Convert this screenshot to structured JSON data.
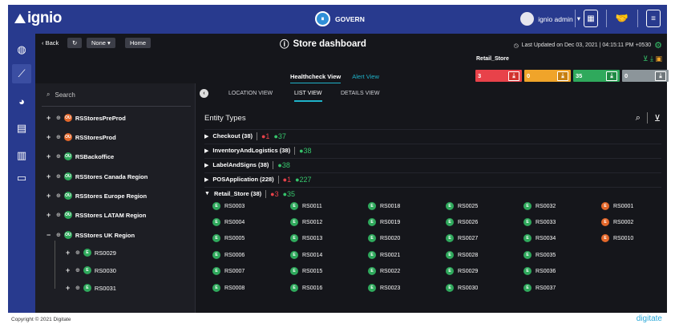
{
  "topbar": {
    "logo": "ignio",
    "govern_label": "GOVERN",
    "user_label": "ignio admin",
    "icon_names": [
      "calendar-icon",
      "handshake-icon",
      "document-icon"
    ]
  },
  "rail": {
    "items": [
      "globe-icon",
      "chart-icon",
      "pie-icon",
      "tree-icon",
      "report-icon",
      "monitor-icon"
    ]
  },
  "subheader": {
    "back_label": "Back",
    "refresh_icon": "refresh-icon",
    "none_label": "None",
    "home_label": "Home",
    "title": "Store dashboard",
    "last_updated": "Last Updated on Dec 03, 2021 | 04:15:11 PM +0530",
    "retail_label": "Retail_Store",
    "view_tabs": [
      "Healthcheck View",
      "Alert View"
    ],
    "tiles": [
      {
        "value": "3",
        "color": "#e8424a"
      },
      {
        "value": "0",
        "color": "#f0a42a"
      },
      {
        "value": "35",
        "color": "#2fa95c"
      },
      {
        "value": "0",
        "color": "#8c959a"
      }
    ]
  },
  "tree": {
    "search_placeholder": "Search",
    "items": [
      {
        "label": "RSStoresPreProd",
        "badge": "OU"
      },
      {
        "label": "RSStoresProd",
        "badge": "OU"
      },
      {
        "label": "RSBackoffice",
        "badge": "OU"
      },
      {
        "label": "RSStores Canada Region",
        "badge": "OU"
      },
      {
        "label": "RSStores Europe Region",
        "badge": "OU"
      },
      {
        "label": "RSStores LATAM Region",
        "badge": "OU"
      },
      {
        "label": "RSStores UK Region",
        "badge": "OU"
      }
    ],
    "children": [
      {
        "label": "RS0029",
        "badge": "E"
      },
      {
        "label": "RS0030",
        "badge": "E"
      },
      {
        "label": "RS0031",
        "badge": "E"
      }
    ]
  },
  "content": {
    "tabs": [
      "LOCATION VIEW",
      "LIST VIEW",
      "DETAILS VIEW"
    ],
    "entity_title": "Entity Types",
    "entity_rows": [
      {
        "label": "Checkout (38)",
        "red": "1",
        "green": "37"
      },
      {
        "label": "InventoryAndLogistics (38)",
        "red": "",
        "green": "38"
      },
      {
        "label": "LabelAndSigns (38)",
        "red": "",
        "green": "38"
      },
      {
        "label": "POSApplication (228)",
        "red": "1",
        "green": "227"
      },
      {
        "label": "Retail_Store (38)",
        "red": "3",
        "green": "35"
      }
    ],
    "stores": [
      [
        "RS0003",
        "RS0011",
        "RS0018",
        "RS0025",
        "RS0032",
        "RS0001"
      ],
      [
        "RS0004",
        "RS0012",
        "RS0019",
        "RS0026",
        "RS0033",
        "RS0002"
      ],
      [
        "RS0005",
        "RS0013",
        "RS0020",
        "RS0027",
        "RS0034",
        "RS0010"
      ],
      [
        "RS0006",
        "RS0014",
        "RS0021",
        "RS0028",
        "RS0035",
        ""
      ],
      [
        "RS0007",
        "RS0015",
        "RS0022",
        "RS0029",
        "RS0036",
        ""
      ],
      [
        "RS0008",
        "RS0016",
        "RS0023",
        "RS0030",
        "RS0037",
        ""
      ]
    ]
  },
  "footer": {
    "copyright": "Copyright © 2021 Digitate",
    "brand": "digitate"
  }
}
